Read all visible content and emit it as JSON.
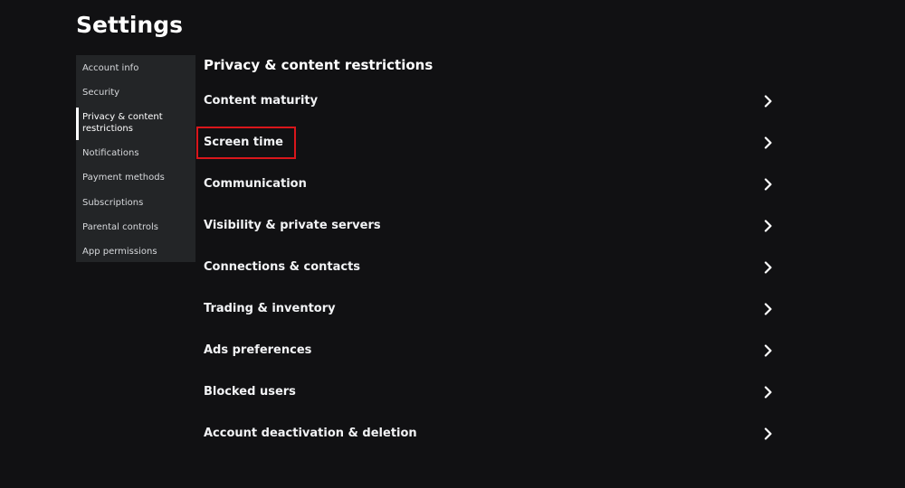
{
  "page": {
    "title": "Settings"
  },
  "sidebar": {
    "items": [
      {
        "label": "Account info",
        "active": false
      },
      {
        "label": "Security",
        "active": false
      },
      {
        "label": "Privacy & content restrictions",
        "active": true
      },
      {
        "label": "Notifications",
        "active": false
      },
      {
        "label": "Payment methods",
        "active": false
      },
      {
        "label": "Subscriptions",
        "active": false
      },
      {
        "label": "Parental controls",
        "active": false
      },
      {
        "label": "App permissions",
        "active": false
      }
    ]
  },
  "main": {
    "section_title": "Privacy & content restrictions",
    "rows": [
      {
        "label": "Content maturity"
      },
      {
        "label": "Screen time"
      },
      {
        "label": "Communication"
      },
      {
        "label": "Visibility & private servers"
      },
      {
        "label": "Connections & contacts"
      },
      {
        "label": "Trading & inventory"
      },
      {
        "label": "Ads preferences"
      },
      {
        "label": "Blocked users"
      },
      {
        "label": "Account deactivation & deletion"
      }
    ]
  },
  "icons": {
    "row_arrow": "chevron-right-icon"
  },
  "colors": {
    "background": "#111113",
    "sidebar_background": "#232527",
    "highlight_border": "#d9161b",
    "text": "#ffffff"
  }
}
